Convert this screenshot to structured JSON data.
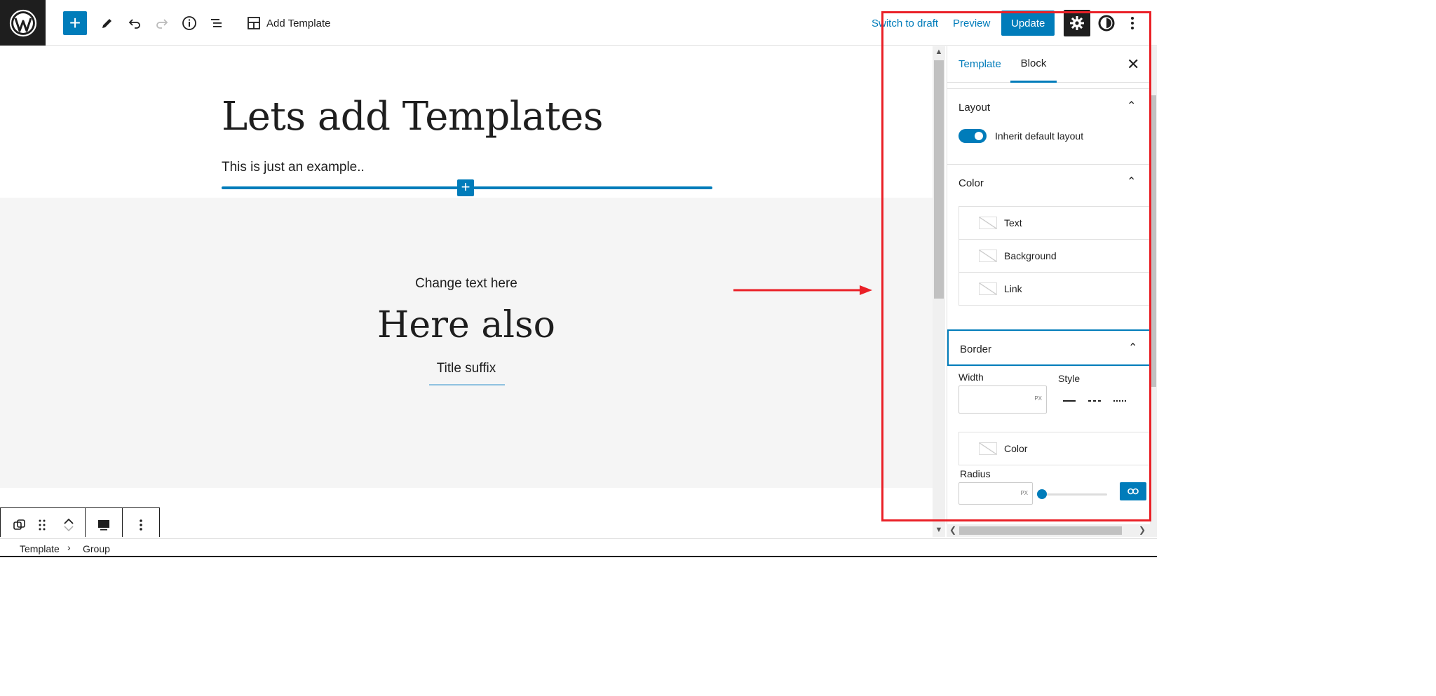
{
  "topbar": {
    "add_template_label": "Add Template",
    "switch_to_draft_label": "Switch to draft",
    "preview_label": "Preview",
    "update_label": "Update"
  },
  "canvas": {
    "title": "Lets add Templates",
    "paragraph": "This is just an example..",
    "group": {
      "change_text": "Change text here",
      "heading": "Here also",
      "title_suffix": "Title suffix"
    }
  },
  "sidebar": {
    "tabs": {
      "template": "Template",
      "block": "Block"
    },
    "layout": {
      "title": "Layout",
      "toggle_label": "Inherit default layout",
      "toggle_on": true
    },
    "color": {
      "title": "Color",
      "items": [
        "Text",
        "Background",
        "Link"
      ]
    },
    "border": {
      "title": "Border",
      "width_label": "Width",
      "style_label": "Style",
      "width_value": "",
      "unit": "PX",
      "color_label": "Color",
      "radius_label": "Radius",
      "radius_value": "",
      "radius_unit": "PX",
      "radius_slider": 0
    }
  },
  "footer": {
    "breadcrumbs": [
      "Template",
      "Group"
    ]
  },
  "colors": {
    "accent": "#007cba",
    "dark": "#1e1e1e",
    "annotation": "#ea2027",
    "canvas_group_bg": "#f5f5f5"
  }
}
